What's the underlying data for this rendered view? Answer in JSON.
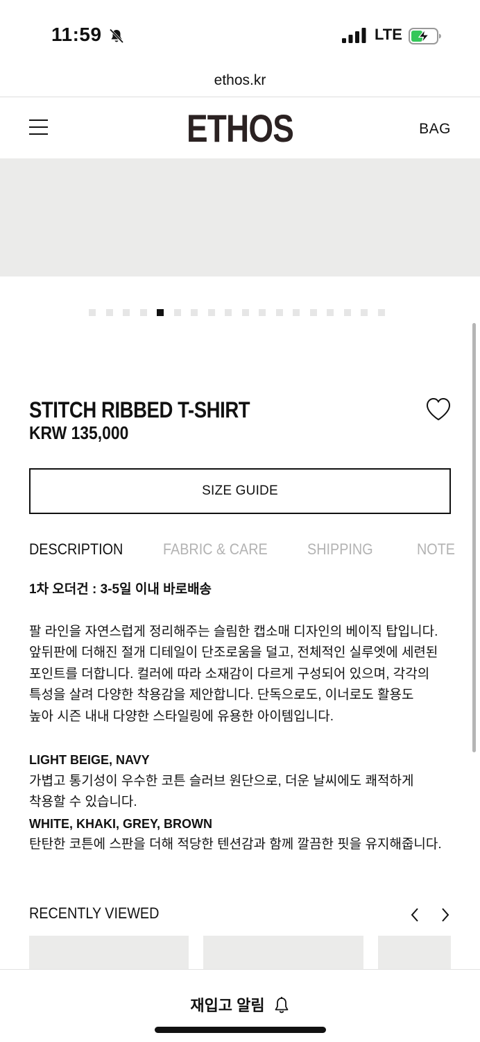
{
  "status_bar": {
    "time": "11:59",
    "network": "LTE",
    "icons": [
      "bell-slash-icon",
      "signal-icon",
      "battery-charging-icon"
    ]
  },
  "browser": {
    "url": "ethos.kr"
  },
  "header": {
    "logo": "ETHOS",
    "bag_label": "BAG",
    "menu_icon": "hamburger-menu-icon"
  },
  "carousel": {
    "total_slides": 18,
    "active_index": 4
  },
  "product": {
    "name": "STITCH RIBBED T-SHIRT",
    "price": "KRW 135,000",
    "wishlist_icon": "heart-icon",
    "size_guide_label": "SIZE GUIDE"
  },
  "tabs": [
    {
      "label": "DESCRIPTION",
      "active": true
    },
    {
      "label": "FABRIC & CARE",
      "active": false
    },
    {
      "label": "SHIPPING",
      "active": false
    },
    {
      "label": "NOTE",
      "active": false
    }
  ],
  "description": {
    "notice": "1차 오더건 : 3-5일 이내 바로배송",
    "paragraph_lines": [
      "팔 라인을 자연스럽게 정리해주는 슬림한 캡소매 디자인의 베이직 탑입니다.",
      "앞뒤판에 더해진 절개 디테일이 단조로움을 덜고, 전체적인 실루엣에 세련된",
      "포인트를 더합니다. 컬러에 따라 소재감이 다르게 구성되어 있으며, 각각의",
      "특성을 살려 다양한 착용감을 제안합니다. 단독으로도, 이너로도 활용도",
      "높아 시즌 내내 다양한 스타일링에 유용한 아이템입니다."
    ],
    "color_group_1_title": "LIGHT BEIGE, NAVY",
    "color_group_1_lines": [
      "가볍고 통기성이 우수한 코튼 슬러브 원단으로, 더운 날씨에도 쾌적하게",
      "착용할 수 있습니다."
    ],
    "color_group_2_title": "WHITE, KHAKI, GREY, BROWN",
    "color_group_2_lines": [
      "탄탄한 코튼에 스판을 더해 적당한 텐션감과 함께 깔끔한 핏을 유지해줍니다."
    ]
  },
  "recently_viewed": {
    "label": "RECENTLY VIEWED",
    "prev_icon": "chevron-left-icon",
    "next_icon": "chevron-right-icon",
    "item_count": 3
  },
  "bottom_bar": {
    "restock_label": "재입고 알림",
    "restock_icon": "bell-icon"
  }
}
